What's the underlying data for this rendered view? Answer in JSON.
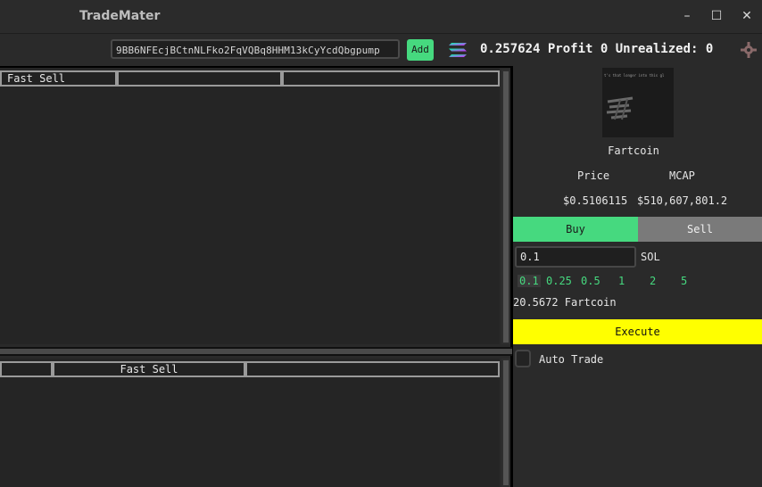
{
  "window": {
    "title": "TradeMater",
    "minimize": "–",
    "maximize": "☐",
    "close": "✕"
  },
  "toolbar": {
    "token_address": "9BB6NFEcjBCtnNLFko2FqVQBq8HHM13kCyYcdQbgpump",
    "add_label": "Add",
    "stats_text": "0.257624 Profit 0 Unrealized: 0",
    "icons": {
      "chain": "solana-logo-icon",
      "settings": "gear-icon"
    }
  },
  "top_table": {
    "headers": [
      "Fast Sell",
      "",
      ""
    ]
  },
  "bottom_table": {
    "headers": [
      "",
      "Fast Sell",
      ""
    ]
  },
  "panel": {
    "coin_name": "Fartcoin",
    "coin_image_text": "t's that longer into this gl",
    "price_label": "Price",
    "mcap_label": "MCAP",
    "price_value": "$0.5106115",
    "mcap_value": "$510,607,801.25",
    "buy_label": "Buy",
    "sell_label": "Sell",
    "amount_value": "0.1",
    "amount_unit": "SOL",
    "quick_amounts": [
      "0.1",
      "0.25",
      "0.5",
      "1",
      "2",
      "5"
    ],
    "estimate_text": "20.5672 Fartcoin",
    "execute_label": "Execute",
    "auto_trade_label": "Auto Trade",
    "colors": {
      "buy": "#46d97f",
      "sell": "#7a7a7a",
      "execute": "#ffff00"
    }
  }
}
